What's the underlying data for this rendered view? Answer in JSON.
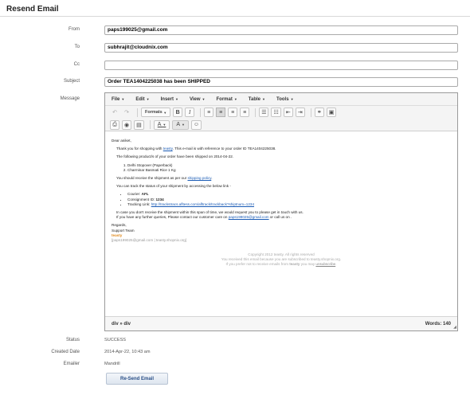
{
  "page": {
    "title": "Resend Email"
  },
  "form": {
    "from_label": "From",
    "from_value": "paps199025@gmail.com",
    "to_label": "To",
    "to_value": "subhrajit@cloudnix.com",
    "cc_label": "Cc",
    "cc_value": "",
    "subject_label": "Subject",
    "subject_value": "Order TEA1404225038 has been SHIPPED",
    "message_label": "Message"
  },
  "editor": {
    "menus": [
      {
        "label": "File"
      },
      {
        "label": "Edit"
      },
      {
        "label": "Insert"
      },
      {
        "label": "View"
      },
      {
        "label": "Format"
      },
      {
        "label": "Table"
      },
      {
        "label": "Tools"
      }
    ],
    "formats_label": "Formats",
    "status_path": "div » div",
    "word_count": "Words: 140"
  },
  "message": {
    "greeting": "Dear aniket,",
    "line1_pre": "Thank you for shopping with ",
    "line1_link": "teasty",
    "line1_post": ". This e-mail is with reference to your order ID TEA1404225038.",
    "line2": "The following product/s of your order have been shipped on 2014-04-22.",
    "products": [
      "Delhi Stopover (Paperback)",
      "Charminar Basmati Rice 1 Kg"
    ],
    "line3_pre": "You should receive the shipment as per our ",
    "line3_link": "shipping policy",
    "line3_post": ".",
    "line4": "You can track the status of your shipment by accessing the below link -",
    "courier_label": "Courier: ",
    "courier_value": "AFL",
    "consignment_label": "Consignment ID: ",
    "consignment_value": "1234",
    "tracking_label": "Tracking Link: ",
    "tracking_link": "http://trackstracs.afltess.com/afltrack/trackback?shiptnum=1234",
    "line5a": "In case you don't receive the shipment within this span of time, we would request you to please get in touch with us.",
    "line5b_pre": "If you have any further queries, Please contact our customer care on ",
    "line5b_link": "paps199025@gmail.com",
    "line5b_post": " or call us on .",
    "sign1": "Regards,",
    "sign2": "Support Team",
    "sign_brand": "teasty",
    "sign_contact": "[paps199025@gmail.com | teasty.shopnix.org]",
    "footer1": "Copyright 2012 teasty. All rights reserved",
    "footer2": "You received this email because you are subscribed to teasty.shopnix.org.",
    "footer3_pre": "If you prefer not to receive emails from ",
    "footer3_brand": "teasty",
    "footer3_mid": " you may ",
    "footer3_link": "unsubscribe",
    "footer3_post": "."
  },
  "info": {
    "status_label": "Status",
    "status_value": "SUCCESS",
    "created_label": "Created Date",
    "created_value": "2014-Apr-22, 10:43 am",
    "emailer_label": "Emailer",
    "emailer_value": "Mandrill"
  },
  "actions": {
    "resend_label": "Re-Send Email"
  }
}
